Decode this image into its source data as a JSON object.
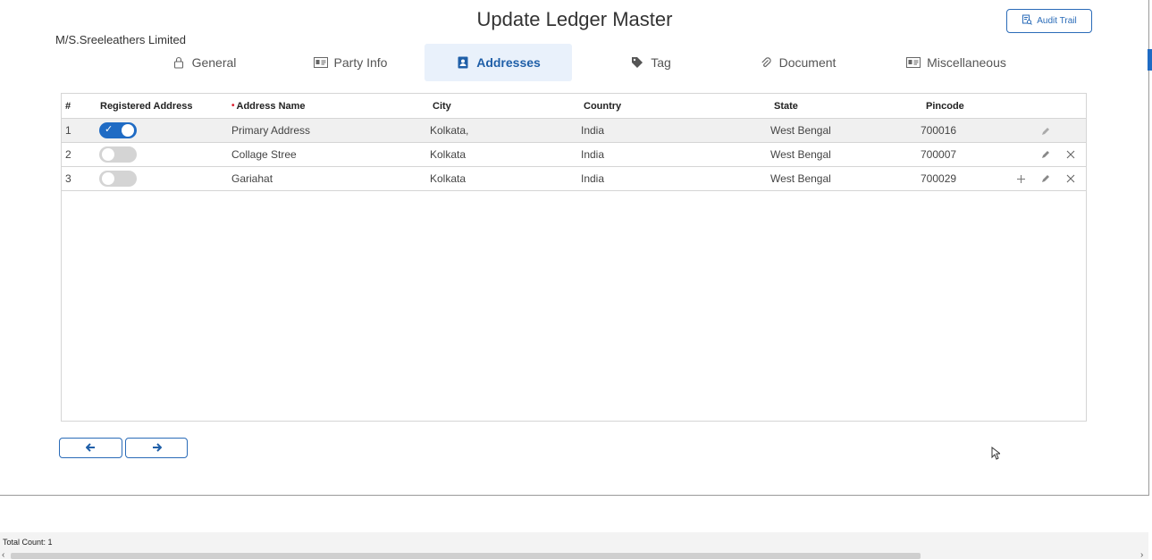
{
  "title": "Update Ledger Master",
  "company": "M/S.Sreeleathers Limited",
  "audit_trail_label": "Audit Trail",
  "tabs": [
    {
      "label": "General",
      "icon": "lock-icon"
    },
    {
      "label": "Party Info",
      "icon": "id-card-icon"
    },
    {
      "label": "Addresses",
      "icon": "address-book-icon",
      "active": true
    },
    {
      "label": "Tag",
      "icon": "tag-icon"
    },
    {
      "label": "Document",
      "icon": "paperclip-icon"
    },
    {
      "label": "Miscellaneous",
      "icon": "id-card-icon"
    }
  ],
  "table": {
    "headers": {
      "num": "#",
      "registered": "Registered Address",
      "address_name": "Address Name",
      "city": "City",
      "country": "Country",
      "state": "State",
      "pincode": "Pincode"
    },
    "rows": [
      {
        "num": "1",
        "registered": true,
        "address_name": "Primary Address",
        "city": "Kolkata,",
        "country": "India",
        "state": "West Bengal",
        "pincode": "700016"
      },
      {
        "num": "2",
        "registered": false,
        "address_name": "Collage Stree",
        "city": "Kolkata",
        "country": "India",
        "state": "West Bengal",
        "pincode": "700007"
      },
      {
        "num": "3",
        "registered": false,
        "address_name": "Gariahat",
        "city": "Kolkata",
        "country": "India",
        "state": "West Bengal",
        "pincode": "700029"
      }
    ]
  },
  "nav": {
    "prev_icon": "arrow-left-icon",
    "next_icon": "arrow-right-icon"
  },
  "footer": {
    "total_count": "Total Count: 1"
  },
  "colors": {
    "accent": "#1f6bc4",
    "active_tab_bg": "#e9f1fb",
    "required": "#d23333"
  }
}
